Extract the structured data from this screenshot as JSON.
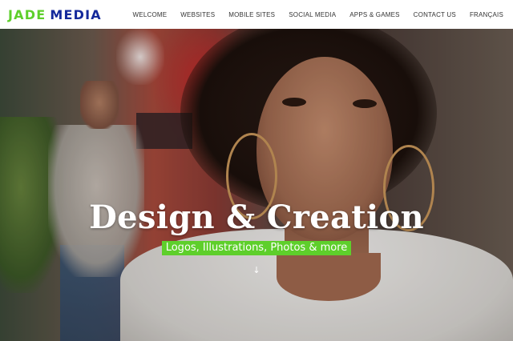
{
  "header": {
    "logo": {
      "word1": "JADE",
      "word2": "MEDIA"
    },
    "nav": [
      {
        "label": "WELCOME"
      },
      {
        "label": "WEBSITES"
      },
      {
        "label": "MOBILE SITES"
      },
      {
        "label": "SOCIAL MEDIA"
      },
      {
        "label": "APPS & GAMES"
      },
      {
        "label": "CONTACT US"
      },
      {
        "label": "FRANÇAIS"
      }
    ]
  },
  "hero": {
    "headline": "Design & Creation",
    "tagline": "Logos, Illustrations, Photos & more",
    "scroll_icon": "arrow-down-icon"
  },
  "colors": {
    "brand_green": "#5ecf2b",
    "brand_blue": "#14299b",
    "nav_text": "#333333",
    "header_bg": "#ffffff"
  }
}
